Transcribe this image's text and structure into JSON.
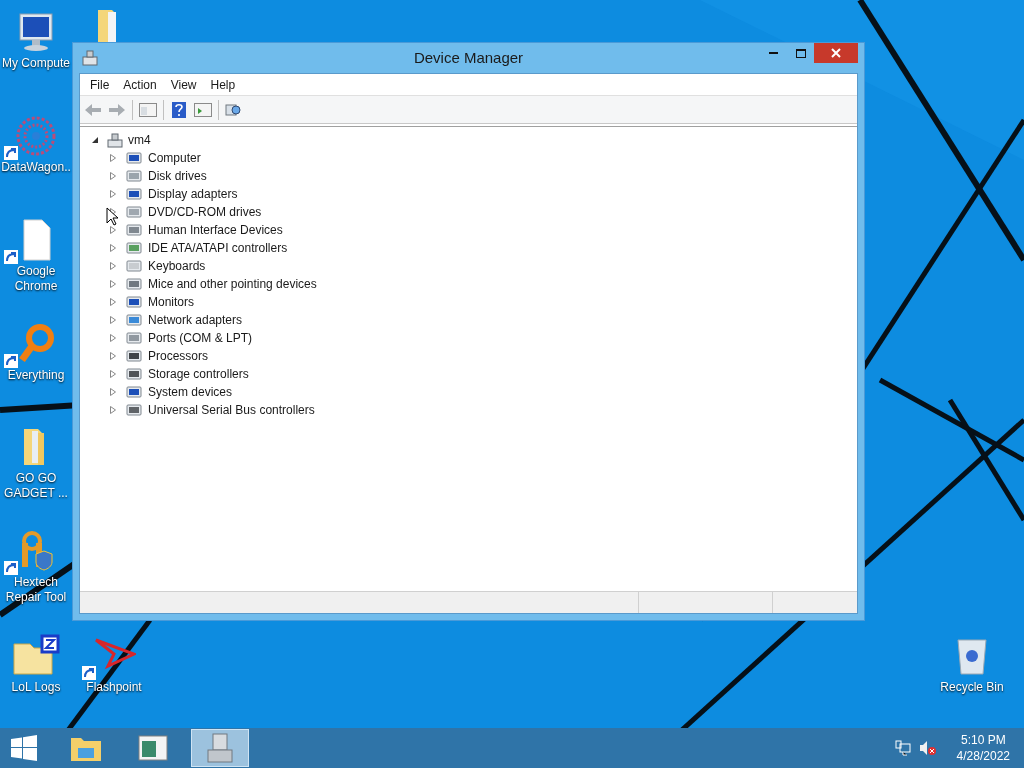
{
  "desktop_icons": [
    {
      "label": "My Compute",
      "shortcut": false
    },
    {
      "label": "DataWagon..",
      "shortcut": true
    },
    {
      "label": "Google Chrome",
      "shortcut": true
    },
    {
      "label": "Everything",
      "shortcut": true
    },
    {
      "label": "GO GO GADGET ...",
      "shortcut": false
    },
    {
      "label": "Hextech Repair Tool",
      "shortcut": true
    },
    {
      "label": "LoL Logs",
      "shortcut": false
    },
    {
      "label": "Flashpoint",
      "shortcut": true
    },
    {
      "label": "Recycle Bin",
      "shortcut": false
    }
  ],
  "window": {
    "title": "Device Manager",
    "menu": [
      "File",
      "Action",
      "View",
      "Help"
    ],
    "tree": {
      "label": "vm4",
      "expanded": true,
      "children": [
        {
          "label": "Computer",
          "expanded": false
        },
        {
          "label": "Disk drives",
          "expanded": false
        },
        {
          "label": "Display adapters",
          "expanded": false
        },
        {
          "label": "DVD/CD-ROM drives",
          "expanded": false
        },
        {
          "label": "Human Interface Devices",
          "expanded": false
        },
        {
          "label": "IDE ATA/ATAPI controllers",
          "expanded": false
        },
        {
          "label": "Keyboards",
          "expanded": false
        },
        {
          "label": "Mice and other pointing devices",
          "expanded": false
        },
        {
          "label": "Monitors",
          "expanded": false
        },
        {
          "label": "Network adapters",
          "expanded": false
        },
        {
          "label": "Ports (COM & LPT)",
          "expanded": false
        },
        {
          "label": "Processors",
          "expanded": false
        },
        {
          "label": "Storage controllers",
          "expanded": false
        },
        {
          "label": "System devices",
          "expanded": false
        },
        {
          "label": "Universal Serial Bus controllers",
          "expanded": false
        }
      ]
    }
  },
  "taskbar": {
    "apps": [
      {
        "selected": false
      },
      {
        "selected": false
      },
      {
        "selected": true
      }
    ],
    "time": "5:10 PM",
    "date": "4/28/2022"
  }
}
